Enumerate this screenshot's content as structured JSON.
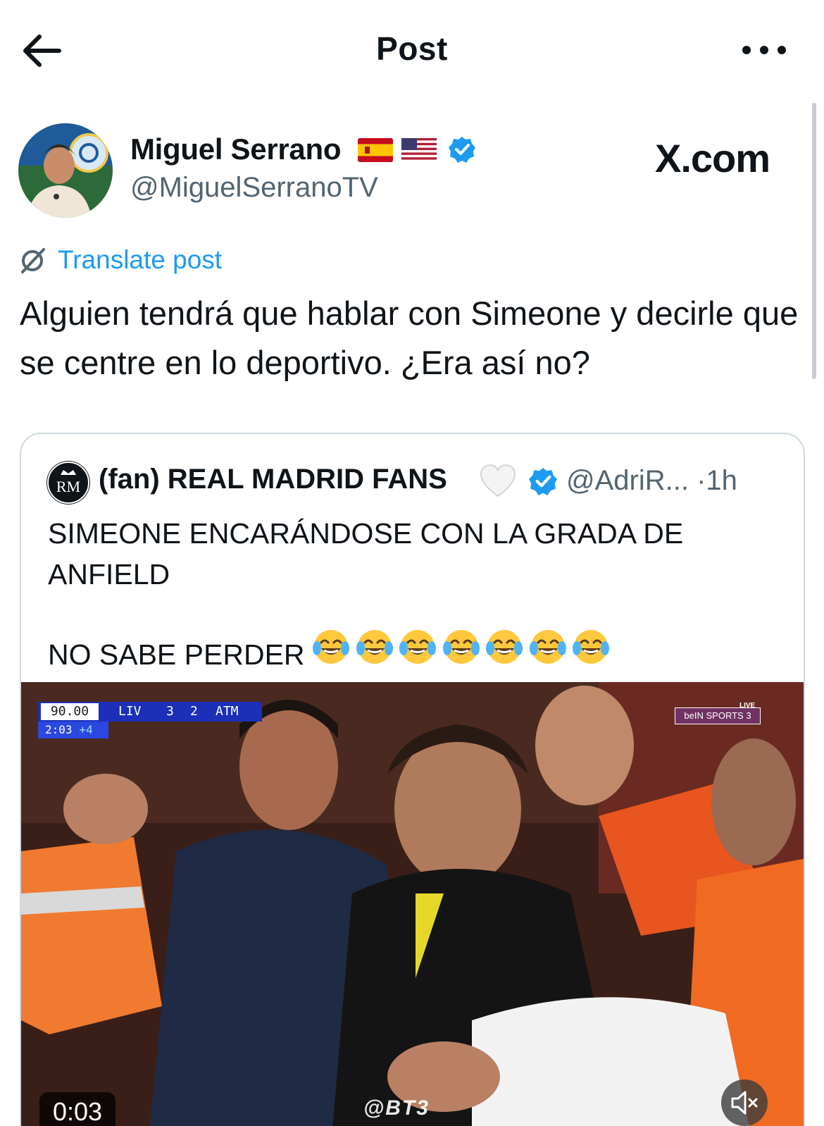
{
  "header": {
    "title": "Post",
    "back_icon": "arrow-left-icon",
    "more_icon": "more-horizontal-icon"
  },
  "author": {
    "name": "Miguel Serrano",
    "flags": [
      "spain-flag-icon",
      "usa-flag-icon"
    ],
    "handle": "@MiguelSerranoTV",
    "verified": true
  },
  "watermark_site": "X.com",
  "translate_label": "Translate post",
  "post_text": "Alguien tendrá que hablar con Simeone y decirle que se centre en lo deportivo. ¿Era así no?",
  "quote": {
    "avatar_text": "RM",
    "name": "(fan) REAL MADRID FANS",
    "handle": "@AdriR...",
    "separator": "·",
    "time": "1h",
    "text_line1": "SIMEONE ENCARÁNDOSE CON LA GRADA DE ANFIELD",
    "text_line2": "NO SABE PERDER",
    "emoji_count": 7,
    "video": {
      "match_clock": "90.00",
      "home": "LIV",
      "home_score": "3",
      "away_score": "2",
      "away": "ATM",
      "extra_clock": "2:03",
      "added_time": "+4",
      "broadcaster": "beIN SPORTS 3",
      "live_label": "LIVE",
      "watermark": "@BT3",
      "duration": "0:03"
    }
  },
  "colors": {
    "accent": "#1d9bf0",
    "text": "#0f1419",
    "secondary": "#536471",
    "border": "#cfd9de"
  }
}
